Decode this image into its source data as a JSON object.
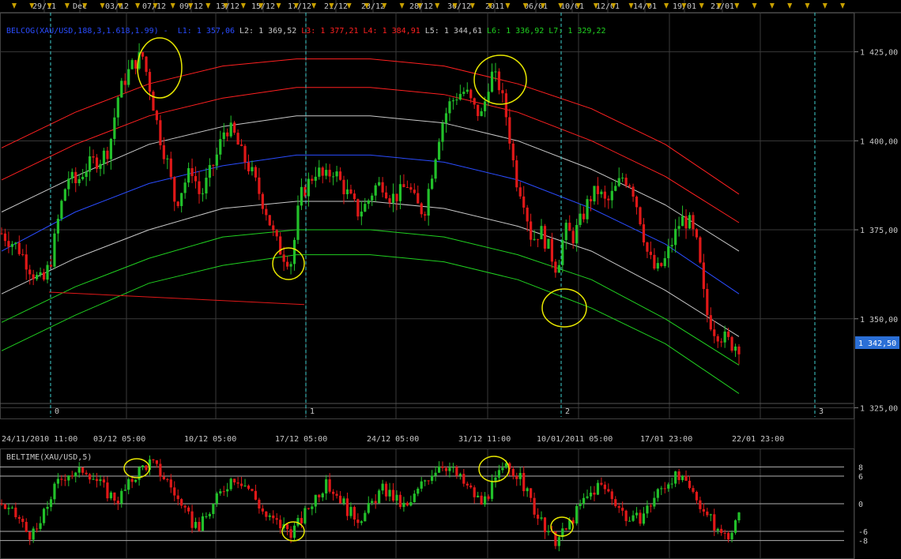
{
  "colors": {
    "background": "#000000",
    "grid": "#3a3a3a",
    "up": "#22c02a",
    "down": "#e01818",
    "tick_marker": "#c8a000",
    "last_price_bg": "#2b6fd6",
    "circle": "#e8e800",
    "cycle_line": "#40d0d0"
  },
  "top_date_labels": [
    "29/11",
    "Dec",
    "03/12",
    "07/12",
    "09/12",
    "13/12",
    "15/12",
    "17/12",
    "21/12",
    "23/12",
    "28/12",
    "30/12",
    "2011",
    "06/01",
    "10/01",
    "12/01",
    "14/01",
    "19/01",
    "21/01"
  ],
  "bottom_date_labels": [
    "24/11/2010 11:00",
    "03/12 05:00",
    "10/12 05:00",
    "17/12 05:00",
    "24/12 05:00",
    "31/12 11:00",
    "10/01/2011 05:00",
    "17/01 23:00",
    "22/01 23:00"
  ],
  "cycle_labels": [
    "0",
    "1",
    "2",
    "3"
  ],
  "main_panel": {
    "legend_prefix": "BELCOG(XAU/USD,188,3,1.618,1.99) -",
    "bands": [
      {
        "label": "L1: 1 357,06",
        "color": "#2a4cff"
      },
      {
        "label": "L2: 1 369,52",
        "color": "#c8c8c8"
      },
      {
        "label": "L3: 1 377,21",
        "color": "#ff2020"
      },
      {
        "label": "L4: 1 384,91",
        "color": "#ff2020"
      },
      {
        "label": "L5: 1 344,61",
        "color": "#c8c8c8"
      },
      {
        "label": "L6: 1 336,92",
        "color": "#20d020"
      },
      {
        "label": "L7: 1 329,22",
        "color": "#20d020"
      }
    ],
    "last_price": "1 342,50"
  },
  "sub_panel": {
    "title": "BELTIME(XAU/USD,5)",
    "level_labels": [
      "8",
      "6",
      "0",
      "-6",
      "-8"
    ]
  },
  "chart_data": [
    {
      "type": "candlestick",
      "title": "",
      "instrument": "XAU/USD",
      "y_axis_ticks": [
        "1 425,00",
        "1 400,00",
        "1 375,00",
        "1 350,00",
        "1 325,00"
      ],
      "ylim": [
        1322,
        1436
      ],
      "last_price": 1342.5,
      "band_curves": [
        {
          "name": "L4",
          "color": "#ff2020",
          "values": [
            1398,
            1408,
            1416,
            1421,
            1423,
            1423,
            1421,
            1416,
            1409,
            1399,
            1385
          ]
        },
        {
          "name": "L3",
          "color": "#ff2020",
          "values": [
            1389,
            1399,
            1407,
            1412,
            1415,
            1415,
            1413,
            1408,
            1400,
            1390,
            1377
          ]
        },
        {
          "name": "L2",
          "color": "#c8c8c8",
          "values": [
            1380,
            1390,
            1399,
            1404,
            1407,
            1407,
            1405,
            1400,
            1392,
            1382,
            1369
          ]
        },
        {
          "name": "L1",
          "color": "#2a4cff",
          "values": [
            1369,
            1380,
            1388,
            1393,
            1396,
            1396,
            1394,
            1389,
            1381,
            1371,
            1357
          ]
        },
        {
          "name": "L5",
          "color": "#c8c8c8",
          "values": [
            1357,
            1367,
            1375,
            1381,
            1383,
            1383,
            1381,
            1376,
            1369,
            1358,
            1345
          ]
        },
        {
          "name": "L6",
          "color": "#20d020",
          "values": [
            1349,
            1359,
            1367,
            1373,
            1375,
            1375,
            1373,
            1368,
            1361,
            1350,
            1337
          ]
        },
        {
          "name": "L7",
          "color": "#20d020",
          "values": [
            1341,
            1351,
            1360,
            1365,
            1368,
            1368,
            1366,
            1361,
            1353,
            1343,
            1329
          ]
        }
      ],
      "close_path": [
        1374,
        1372,
        1370,
        1366,
        1362,
        1360,
        1367,
        1380,
        1390,
        1388,
        1392,
        1394,
        1395,
        1398,
        1412,
        1418,
        1422,
        1424,
        1414,
        1402,
        1394,
        1382,
        1388,
        1392,
        1384,
        1390,
        1396,
        1404,
        1402,
        1396,
        1392,
        1386,
        1380,
        1372,
        1368,
        1366,
        1384,
        1388,
        1392,
        1389,
        1392,
        1388,
        1384,
        1380,
        1382,
        1387,
        1388,
        1384,
        1385,
        1388,
        1382,
        1380,
        1392,
        1404,
        1410,
        1413,
        1414,
        1409,
        1407,
        1419,
        1416,
        1406,
        1390,
        1384,
        1372,
        1375,
        1370,
        1364,
        1375,
        1373,
        1378,
        1384,
        1386,
        1382,
        1386,
        1390,
        1388,
        1379,
        1368,
        1363,
        1366,
        1372,
        1378,
        1377,
        1370,
        1352,
        1347,
        1345,
        1343,
        1342.5
      ]
    },
    {
      "type": "bar",
      "title": "",
      "name": "BELTIME(XAU/USD,5)",
      "levels": [
        8,
        6,
        0,
        -6,
        -8
      ],
      "ylim": [
        -12,
        12
      ],
      "values": [
        0,
        -2,
        -3,
        -6,
        -7,
        -3,
        2,
        5,
        7,
        6,
        8,
        6,
        4,
        2,
        1,
        3,
        6,
        8,
        9,
        7,
        5,
        2,
        -2,
        -4,
        -5,
        -2,
        1,
        4,
        6,
        5,
        3,
        0,
        -3,
        -4,
        -5,
        -6,
        -4,
        -1,
        2,
        4,
        3,
        1,
        -2,
        -3,
        -2,
        1,
        3,
        2,
        0,
        -1,
        2,
        5,
        7,
        9,
        8,
        6,
        4,
        2,
        0,
        3,
        6,
        8,
        7,
        4,
        0,
        -4,
        -7,
        -8,
        -6,
        -3,
        0,
        2,
        4,
        3,
        1,
        -2,
        -4,
        -3,
        -1,
        2,
        4,
        6,
        5,
        3,
        1,
        -2,
        -5,
        -7,
        -6,
        -3
      ]
    }
  ]
}
